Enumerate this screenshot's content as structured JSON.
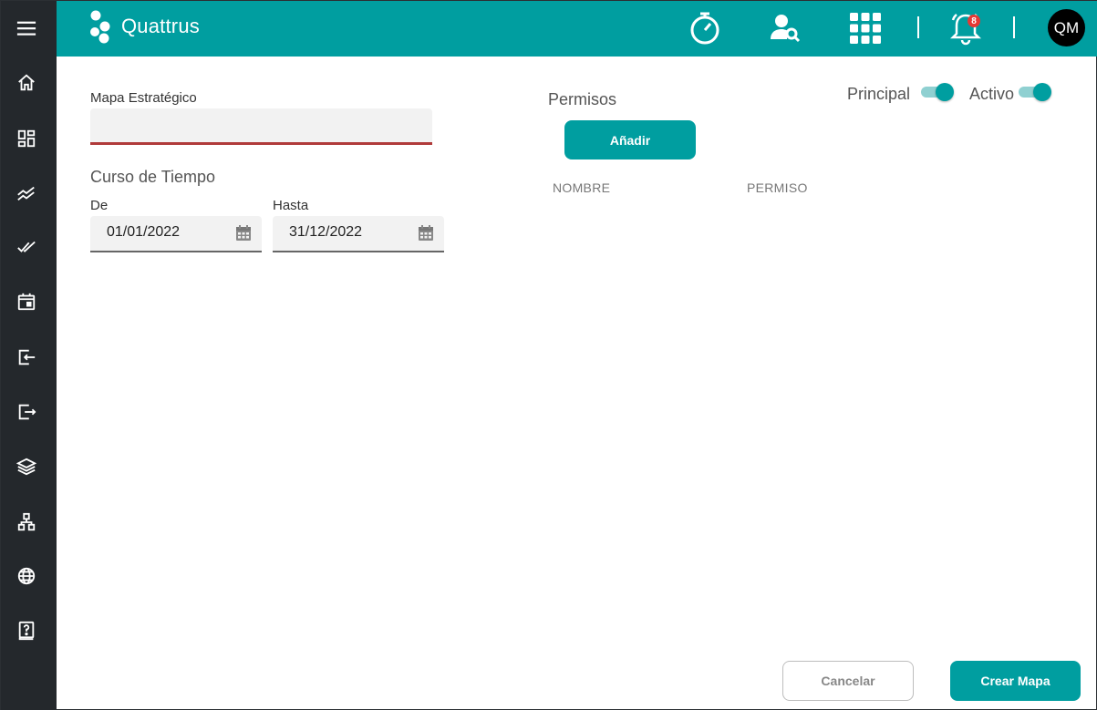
{
  "app": {
    "name": "Quattrus"
  },
  "colors": {
    "brand": "#009ea0",
    "sidebar": "#24282c",
    "error": "#b03a3a",
    "badge": "#e53935"
  },
  "sidebar": {
    "items": [
      {
        "icon": "menu-icon"
      },
      {
        "icon": "home-icon"
      },
      {
        "icon": "dashboard-icon"
      },
      {
        "icon": "trending-icon"
      },
      {
        "icon": "double-check-icon"
      },
      {
        "icon": "calendar-icon"
      },
      {
        "icon": "import-icon"
      },
      {
        "icon": "export-icon"
      },
      {
        "icon": "layers-icon"
      },
      {
        "icon": "hierarchy-icon"
      },
      {
        "icon": "globe-icon"
      },
      {
        "icon": "help-icon"
      }
    ]
  },
  "header": {
    "notifications_count": "8",
    "avatar_initials": "QM",
    "icons": [
      "timer-icon",
      "user-search-icon",
      "apps-grid-icon",
      "bell-icon"
    ]
  },
  "form": {
    "map_label": "Mapa Estratégico",
    "map_value": "",
    "time_title": "Curso de Tiempo",
    "from_label": "De",
    "from_value": "01/01/2022",
    "to_label": "Hasta",
    "to_value": "31/12/2022"
  },
  "permissions": {
    "title": "Permisos",
    "add_label": "Añadir",
    "columns": [
      "NOMBRE",
      "PERMISO"
    ]
  },
  "toggles": {
    "principal_label": "Principal",
    "principal_on": true,
    "active_label": "Activo",
    "active_on": true
  },
  "actions": {
    "cancel_label": "Cancelar",
    "create_label": "Crear Mapa"
  }
}
